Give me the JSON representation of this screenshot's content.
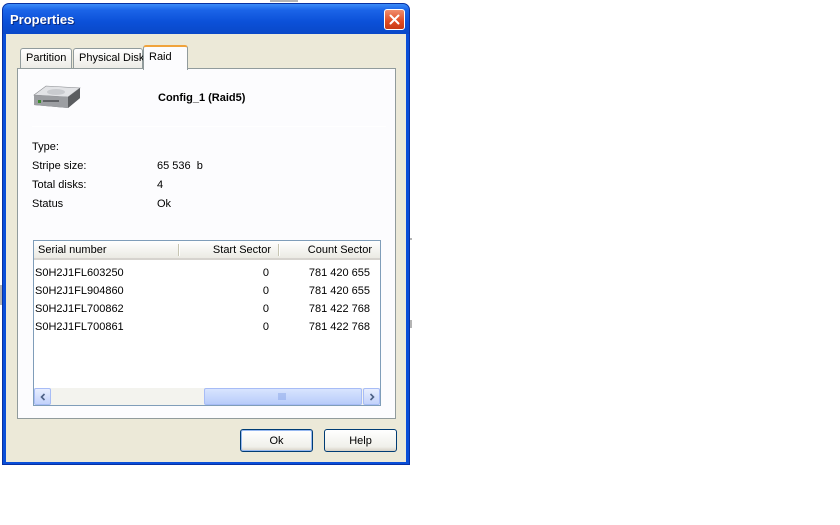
{
  "window": {
    "title": "Properties",
    "close_icon": "close-icon"
  },
  "tabs": [
    {
      "label": "Partition",
      "active": false
    },
    {
      "label": "Physical Disk",
      "active": false
    },
    {
      "label": "Raid",
      "active": true
    }
  ],
  "raid": {
    "icon": "hard-disk-icon",
    "name": "Config_1 (Raid5)",
    "properties": [
      {
        "label": "Type:",
        "value": ""
      },
      {
        "label": "Stripe size:",
        "value": "65 536  b"
      },
      {
        "label": "Total disks:",
        "value": "4"
      },
      {
        "label": "Status",
        "value": "Ok"
      }
    ]
  },
  "disk_table": {
    "columns": [
      "Serial number",
      "Start Sector",
      "Count Sector"
    ],
    "rows": [
      [
        "S0H2J1FL603250",
        "0",
        "781 420 655"
      ],
      [
        "S0H2J1FL904860",
        "0",
        "781 420 655"
      ],
      [
        "S0H2J1FL700862",
        "0",
        "781 422 768"
      ],
      [
        "S0H2J1FL700861",
        "0",
        "781 422 768"
      ]
    ]
  },
  "buttons": {
    "ok": "Ok",
    "help": "Help"
  },
  "colors": {
    "titlebar": "#0a54e0",
    "close_button": "#e04a22",
    "dialog_face": "#ece9d8",
    "active_tab_accent": "#f0a33c"
  }
}
